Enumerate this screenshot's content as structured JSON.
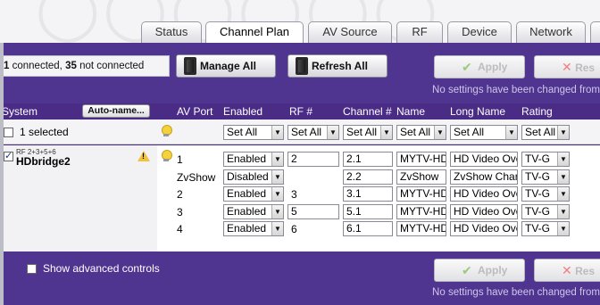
{
  "tabs": [
    {
      "label": "Status",
      "active": false
    },
    {
      "label": "Channel Plan",
      "active": true
    },
    {
      "label": "AV Source",
      "active": false
    },
    {
      "label": "RF",
      "active": false
    },
    {
      "label": "Device",
      "active": false
    },
    {
      "label": "Network",
      "active": false
    }
  ],
  "toolbar": {
    "connected_count": "1",
    "connected_text": "connected,",
    "not_connected_count": "35",
    "not_connected_text": "not connected",
    "manage_all": "Manage All",
    "refresh_all": "Refresh All",
    "apply": "Apply",
    "reset": "Res",
    "no_changes": "No settings have been changed from"
  },
  "table": {
    "headers": {
      "system": "System",
      "auto_name": "Auto-name...",
      "av_port": "AV Port",
      "enabled": "Enabled",
      "rf": "RF #",
      "channel": "Channel #",
      "name": "Name",
      "long_name": "Long Name",
      "rating": "Rating"
    },
    "selection": {
      "label": "1 selected",
      "set_all": "Set All"
    },
    "device": {
      "rf_label": "RF 2+3+5+6",
      "name": "HDbridge2"
    },
    "rows": [
      {
        "av_port": "1",
        "enabled": "Enabled",
        "rf": "2",
        "rf_input": true,
        "channel": "2.1",
        "name": "MYTV-HD",
        "long_name": "HD Video Ove",
        "rating": "TV-G"
      },
      {
        "av_port": "ZvShow",
        "enabled": "Disabled",
        "rf": "",
        "rf_input": false,
        "channel": "2.2",
        "name": "ZvShow",
        "long_name": "ZvShow Char",
        "rating": "TV-G"
      },
      {
        "av_port": "2",
        "enabled": "Enabled",
        "rf": "3",
        "rf_input": false,
        "channel": "3.1",
        "name": "MYTV-HD",
        "long_name": "HD Video Ove",
        "rating": "TV-G"
      },
      {
        "av_port": "3",
        "enabled": "Enabled",
        "rf": "5",
        "rf_input": true,
        "channel": "5.1",
        "name": "MYTV-HD",
        "long_name": "HD Video Ove",
        "rating": "TV-G"
      },
      {
        "av_port": "4",
        "enabled": "Enabled",
        "rf": "6",
        "rf_input": false,
        "channel": "6.1",
        "name": "MYTV-HD",
        "long_name": "HD Video Ove",
        "rating": "TV-G"
      }
    ]
  },
  "footer": {
    "show_advanced": "Show advanced controls"
  },
  "colors": {
    "frame_purple": "#4a2c86",
    "bar_purple": "#4f3490",
    "warning_yellow": "#f2c23a"
  }
}
